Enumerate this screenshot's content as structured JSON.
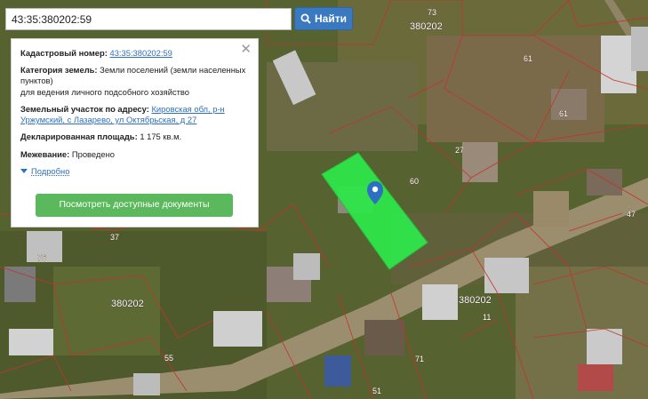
{
  "search": {
    "value": "43:35:380202:59",
    "button_label": "Найти"
  },
  "info": {
    "cad_label": "Кадастровый номер:",
    "cad_value": "43:35:380202:59",
    "category_label": "Категория земель:",
    "category_value": "Земли поселений (земли населенных пунктов)",
    "category_use": "для ведения личного подсобного хозяйство",
    "address_label": "Земельный участок по адресу:",
    "address_value": "Кировская обл, р-н Уржумский, с Лазарево, ул Октябрьская, д 27",
    "area_label": "Декларированная площадь:",
    "area_value": "1 175 кв.м.",
    "survey_label": "Межевание:",
    "survey_value": "Проведено",
    "more_label": "Подробно",
    "docs_button": "Посмотреть доступные документы"
  },
  "map": {
    "labels": [
      "73",
      "380202",
      "61",
      "61",
      "27",
      "60",
      "47",
      "37",
      "76",
      "380202",
      "380202",
      "55",
      "71",
      "11",
      "51"
    ],
    "selected_parcel_color": "#2ee64a",
    "marker_color": "#2d6fc1"
  }
}
